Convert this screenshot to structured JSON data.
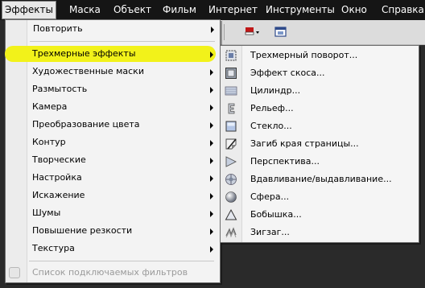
{
  "menubar": {
    "items": [
      {
        "label": "Эффекты"
      },
      {
        "label": "Маска"
      },
      {
        "label": "Объект"
      },
      {
        "label": "Фильм"
      },
      {
        "label": "Интернет"
      },
      {
        "label": "Инструменты"
      },
      {
        "label": "Окно"
      },
      {
        "label": "Справка"
      }
    ]
  },
  "menu": {
    "items": [
      {
        "label": "Повторить"
      },
      {
        "label": "Трехмерные эффекты"
      },
      {
        "label": "Художественные маски"
      },
      {
        "label": "Размытость"
      },
      {
        "label": "Камера"
      },
      {
        "label": "Преобразование цвета"
      },
      {
        "label": "Контур"
      },
      {
        "label": "Творческие"
      },
      {
        "label": "Настройка"
      },
      {
        "label": "Искажение"
      },
      {
        "label": "Шумы"
      },
      {
        "label": "Повышение резкости"
      },
      {
        "label": "Текстура"
      },
      {
        "label": "Список подключаемых фильтров"
      }
    ]
  },
  "submenu": {
    "items": [
      {
        "label": "Трехмерный поворот...",
        "icon": "rotate-3d-icon"
      },
      {
        "label": "Эффект скоса...",
        "icon": "bevel-icon"
      },
      {
        "label": "Цилиндр...",
        "icon": "cylinder-icon"
      },
      {
        "label": "Рельеф...",
        "icon": "emboss-icon"
      },
      {
        "label": "Стекло...",
        "icon": "glass-icon"
      },
      {
        "label": "Загиб края страницы...",
        "icon": "page-curl-icon"
      },
      {
        "label": "Перспектива...",
        "icon": "perspective-icon"
      },
      {
        "label": "Вдавливание/выдавливание...",
        "icon": "pinch-punch-icon"
      },
      {
        "label": "Сфера...",
        "icon": "sphere-icon"
      },
      {
        "label": "Бобышка...",
        "icon": "boss-icon"
      },
      {
        "label": "Зигзаг...",
        "icon": "zigzag-icon"
      }
    ]
  },
  "colors": {
    "menubar_bg": "#151515",
    "highlight": "#f2f21a",
    "menu_bg": "#f3f3f3"
  }
}
